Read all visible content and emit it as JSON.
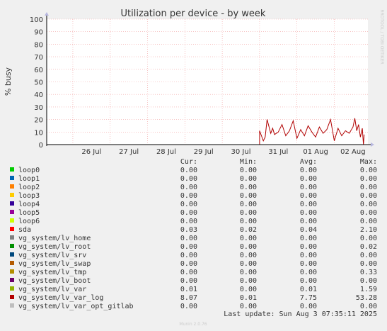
{
  "chart_data": {
    "type": "line",
    "title": "Utilization per device - by week",
    "ylabel": "% busy",
    "ylim": [
      0,
      100
    ],
    "yticks": [
      0,
      10,
      20,
      30,
      40,
      50,
      60,
      70,
      80,
      90,
      100
    ],
    "xticks": [
      "26 Jul",
      "27 Jul",
      "28 Jul",
      "29 Jul",
      "30 Jul",
      "31 Jul",
      "01 Aug",
      "02 Aug"
    ],
    "x_range_days": [
      -0.7,
      7.9
    ],
    "grid": true,
    "side_label": "RRDTOOL / TOBI OETIKER",
    "series": [
      {
        "name": "vg_system/lv_var_log",
        "color": "#b00000",
        "x_days": [
          5.0,
          5.0,
          5.1,
          5.15,
          5.2,
          5.3,
          5.35,
          5.4,
          5.5,
          5.6,
          5.7,
          5.8,
          5.9,
          6.0,
          6.1,
          6.2,
          6.3,
          6.4,
          6.5,
          6.6,
          6.7,
          6.8,
          6.9,
          7.0,
          7.1,
          7.2,
          7.3,
          7.4,
          7.5,
          7.55,
          7.6,
          7.65,
          7.7,
          7.75,
          7.78,
          7.8
        ],
        "values": [
          0,
          11,
          3,
          6,
          20,
          9,
          13,
          8,
          10,
          16,
          7,
          11,
          19,
          5,
          12,
          7,
          15,
          10,
          6,
          14,
          9,
          12,
          20,
          3,
          13,
          7,
          11,
          9,
          14,
          21,
          11,
          16,
          6,
          13,
          0,
          8
        ]
      }
    ]
  },
  "legend": {
    "headers": {
      "cur": "Cur:",
      "min": "Min:",
      "avg": "Avg:",
      "max": "Max:"
    },
    "rows": [
      {
        "name": "loop0",
        "color": "#00cc00",
        "cur": "0.00",
        "min": "0.00",
        "avg": "0.00",
        "max": "0.00"
      },
      {
        "name": "loop1",
        "color": "#0066b3",
        "cur": "0.00",
        "min": "0.00",
        "avg": "0.00",
        "max": "0.00"
      },
      {
        "name": "loop2",
        "color": "#ff8000",
        "cur": "0.00",
        "min": "0.00",
        "avg": "0.00",
        "max": "0.00"
      },
      {
        "name": "loop3",
        "color": "#ffcc00",
        "cur": "0.00",
        "min": "0.00",
        "avg": "0.00",
        "max": "0.00"
      },
      {
        "name": "loop4",
        "color": "#330099",
        "cur": "0.00",
        "min": "0.00",
        "avg": "0.00",
        "max": "0.00"
      },
      {
        "name": "loop5",
        "color": "#990099",
        "cur": "0.00",
        "min": "0.00",
        "avg": "0.00",
        "max": "0.00"
      },
      {
        "name": "loop6",
        "color": "#ccff00",
        "cur": "0.00",
        "min": "0.00",
        "avg": "0.00",
        "max": "0.00"
      },
      {
        "name": "sda",
        "color": "#ff0000",
        "cur": "0.03",
        "min": "0.02",
        "avg": "0.04",
        "max": "2.10"
      },
      {
        "name": "vg_system/lv_home",
        "color": "#808080",
        "cur": "0.00",
        "min": "0.00",
        "avg": "0.00",
        "max": "0.00"
      },
      {
        "name": "vg_system/lv_root",
        "color": "#008f00",
        "cur": "0.00",
        "min": "0.00",
        "avg": "0.00",
        "max": "0.02"
      },
      {
        "name": "vg_system/lv_srv",
        "color": "#00487d",
        "cur": "0.00",
        "min": "0.00",
        "avg": "0.00",
        "max": "0.00"
      },
      {
        "name": "vg_system/lv_swap",
        "color": "#b35a00",
        "cur": "0.00",
        "min": "0.00",
        "avg": "0.00",
        "max": "0.00"
      },
      {
        "name": "vg_system/lv_tmp",
        "color": "#b38f00",
        "cur": "0.00",
        "min": "0.00",
        "avg": "0.00",
        "max": "0.33"
      },
      {
        "name": "vg_system/lv_boot",
        "color": "#6b006b",
        "cur": "0.00",
        "min": "0.00",
        "avg": "0.00",
        "max": "0.00"
      },
      {
        "name": "vg_system/lv_var",
        "color": "#8fb300",
        "cur": "0.01",
        "min": "0.00",
        "avg": "0.01",
        "max": "1.59"
      },
      {
        "name": "vg_system/lv_var_log",
        "color": "#b30000",
        "cur": "8.07",
        "min": "0.01",
        "avg": "7.75",
        "max": "53.28"
      },
      {
        "name": "vg_system/lv_var_opt_gitlab",
        "color": "#bebebe",
        "cur": "0.00",
        "min": "0.00",
        "avg": "0.00",
        "max": "0.00"
      }
    ]
  },
  "footer": {
    "last_update": "Last update: Sun Aug  3 07:35:11 2025",
    "munin_version": "Munin 2.0.76"
  }
}
